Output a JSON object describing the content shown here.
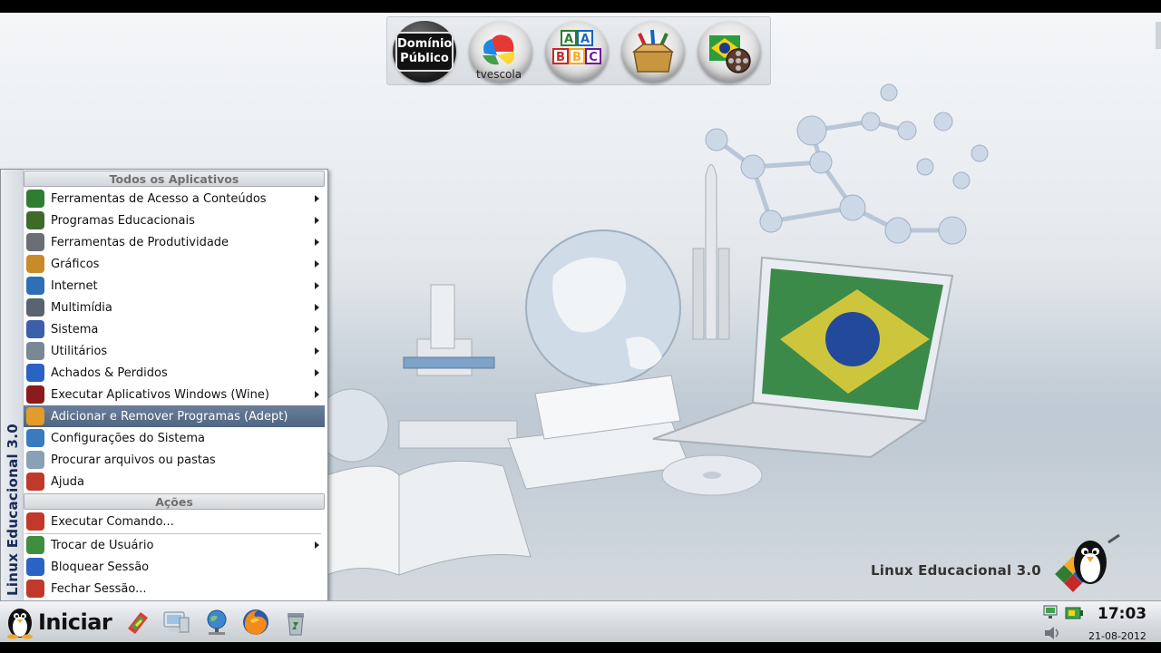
{
  "quick_launch": {
    "items": [
      {
        "name": "dominio-publico",
        "line1": "Domínio",
        "line2": "Público"
      },
      {
        "name": "tv-escola",
        "label": "tvescola"
      },
      {
        "name": "abc-blocks"
      },
      {
        "name": "school-box"
      },
      {
        "name": "brazil-film"
      }
    ]
  },
  "desktop": {
    "brand_text": "Linux Educacional 3.0"
  },
  "menu": {
    "side_title": "Linux Educacional 3.0",
    "all_apps_header": "Todos os Aplicativos",
    "actions_header": "Ações",
    "apps": [
      {
        "label": "Ferramentas de Acesso a Conteúdos",
        "icon": "mec-icon",
        "color": "#2e7d32",
        "submenu": true
      },
      {
        "label": "Programas Educacionais",
        "icon": "chalkboard-icon",
        "color": "#3f6b2a",
        "submenu": true
      },
      {
        "label": "Ferramentas de Produtividade",
        "icon": "typewriter-icon",
        "color": "#6a6f75",
        "submenu": true
      },
      {
        "label": "Gráficos",
        "icon": "palette-icon",
        "color": "#c98a2a",
        "submenu": true
      },
      {
        "label": "Internet",
        "icon": "globe-icon",
        "color": "#2f6fb5",
        "submenu": true
      },
      {
        "label": "Multimídia",
        "icon": "speaker-icon",
        "color": "#5a6470",
        "submenu": true
      },
      {
        "label": "Sistema",
        "icon": "system-icon",
        "color": "#3b5fa8",
        "submenu": true
      },
      {
        "label": "Utilitários",
        "icon": "tools-icon",
        "color": "#7a8794",
        "submenu": true
      },
      {
        "label": "Achados & Perdidos",
        "icon": "question-icon",
        "color": "#2a63c4",
        "submenu": true
      },
      {
        "label": "Executar Aplicativos Windows (Wine)",
        "icon": "wine-icon",
        "color": "#8b1b1b",
        "submenu": true
      },
      {
        "label": "Adicionar e Remover Programas (Adept)",
        "icon": "adept-icon",
        "color": "#e39b2a",
        "submenu": false,
        "highlighted": true
      },
      {
        "label": "Configurações do Sistema",
        "icon": "settings-icon",
        "color": "#3a7bbf",
        "submenu": false
      },
      {
        "label": "Procurar arquivos ou pastas",
        "icon": "find-icon",
        "color": "#8aa0b5",
        "submenu": false
      },
      {
        "label": "Ajuda",
        "icon": "lifebuoy-icon",
        "color": "#c0392b",
        "submenu": false
      }
    ],
    "actions": [
      {
        "label": "Executar Comando...",
        "icon": "run-icon",
        "color": "#c0392b",
        "submenu": false
      },
      {
        "label": "Trocar de Usuário",
        "icon": "user-icon",
        "color": "#3e8e3e",
        "submenu": true
      },
      {
        "label": "Bloquear Sessão",
        "icon": "lock-icon",
        "color": "#2a63c4",
        "submenu": false
      },
      {
        "label": "Fechar Sessão...",
        "icon": "power-icon",
        "color": "#c0392b",
        "submenu": false
      }
    ]
  },
  "taskbar": {
    "start_label": "Iniciar",
    "apps": [
      {
        "name": "taskbar-paint-app"
      },
      {
        "name": "taskbar-computer-app"
      },
      {
        "name": "taskbar-network-app"
      },
      {
        "name": "taskbar-firefox-app"
      },
      {
        "name": "taskbar-trash-app"
      }
    ],
    "clock": "17:03",
    "date": "21-08-2012"
  }
}
